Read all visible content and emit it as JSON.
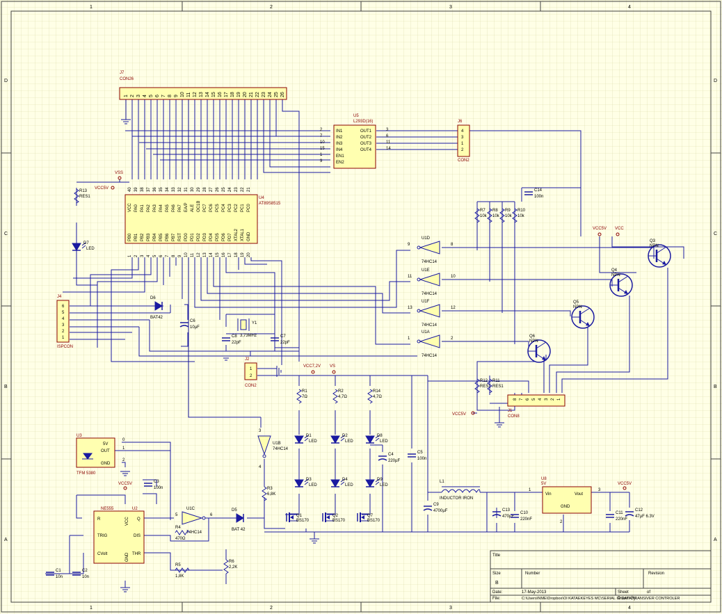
{
  "colors": {
    "background": "#ffffe6",
    "grid": "#d9d9a8",
    "border": "#404040",
    "wire": "#1a1aa0",
    "component": "#8b0000",
    "component_fill": "#ffffb0",
    "label": "#000000",
    "power": "#8b0000"
  },
  "border": {
    "columns": [
      "1",
      "2",
      "3",
      "4"
    ],
    "rows": [
      "D",
      "C",
      "B",
      "A"
    ]
  },
  "connectors": {
    "J7": {
      "ref": "J7",
      "name": "CON26",
      "pins": [
        "1",
        "2",
        "3",
        "4",
        "5",
        "6",
        "7",
        "8",
        "9",
        "10",
        "11",
        "12",
        "13",
        "14",
        "15",
        "16",
        "17",
        "18",
        "19",
        "20",
        "21",
        "22",
        "23",
        "24",
        "25",
        "26"
      ]
    },
    "J6": {
      "ref": "J6",
      "name": "CON2",
      "pins": [
        "4",
        "3",
        "1",
        "2"
      ]
    },
    "J4": {
      "ref": "J4",
      "name": "ISPCON",
      "pins": [
        "6",
        "5",
        "4",
        "3",
        "2",
        "1"
      ]
    },
    "J2": {
      "ref": "J2",
      "name": "CON2",
      "pins": [
        "1",
        "2"
      ]
    },
    "J1": {
      "ref": "J1",
      "name": "CON8",
      "pins": [
        "8",
        "7",
        "6",
        "5",
        "4",
        "3",
        "2",
        "1"
      ]
    }
  },
  "ics": {
    "U5": {
      "ref": "U5",
      "part": "L293D(16)",
      "inputs": [
        "IN1",
        "IN2",
        "IN3",
        "IN4",
        "EN1",
        "EN2"
      ],
      "input_pins": [
        "2",
        "7",
        "10",
        "15",
        "1",
        "9"
      ],
      "outputs": [
        "OUT1",
        "OUT2",
        "OUT3",
        "OUT4"
      ],
      "output_pins": [
        "3",
        "6",
        "11",
        "14"
      ]
    },
    "U4": {
      "ref": "U4",
      "part": "AT89S8515",
      "top_labels": [
        "VCC",
        "PA0",
        "PA1",
        "PA2",
        "PA3",
        "PA4",
        "PA5",
        "PA6",
        "PA7",
        "EA/P",
        "ALE",
        "OC1B",
        "PC7",
        "PC6",
        "PC5",
        "PC4",
        "PC3",
        "PC2",
        "PC1",
        "PC0"
      ],
      "top_pins": [
        "40",
        "39",
        "38",
        "37",
        "36",
        "35",
        "34",
        "33",
        "32",
        "31",
        "30",
        "29",
        "28",
        "27",
        "26",
        "25",
        "24",
        "23",
        "22",
        "21"
      ],
      "bottom_labels": [
        "PB0",
        "PB1",
        "PB2",
        "PB3",
        "PB4",
        "PB5",
        "PB6",
        "PB7",
        "RST",
        "PD0",
        "PD1",
        "PD2",
        "PD3",
        "PD4",
        "PD5",
        "PD6",
        "PD7",
        "XTAL2",
        "XTAL1",
        "GND"
      ],
      "bottom_pins": [
        "1",
        "2",
        "3",
        "4",
        "5",
        "6",
        "7",
        "8",
        "9",
        "10",
        "11",
        "12",
        "13",
        "14",
        "15",
        "16",
        "17",
        "18",
        "19",
        "20"
      ]
    },
    "U2": {
      "ref": "U2",
      "part": "NE555",
      "labels": [
        "R",
        "VCC",
        "Q",
        "TRIG",
        "DIS",
        "CVolt",
        "GND",
        "THR"
      ]
    },
    "U3": {
      "ref": "U3",
      "part": "TFM 5380",
      "labels": [
        "5V",
        "OUT",
        "GND"
      ],
      "pins": [
        "0",
        "1",
        "2"
      ]
    },
    "U8": {
      "ref": "U8",
      "part": "5V",
      "labels": [
        "Vin",
        "Vout",
        "GND"
      ],
      "pins": [
        "1",
        "3",
        "2"
      ]
    }
  },
  "inverters": [
    {
      "ref": "U1D",
      "part": "74HC14",
      "in": "8",
      "out": "9"
    },
    {
      "ref": "U1E",
      "part": "74HC14",
      "in": "10",
      "out": "11"
    },
    {
      "ref": "U1F",
      "part": "74HC14",
      "in": "12",
      "out": "13"
    },
    {
      "ref": "U1A",
      "part": "74HC14",
      "in": "2",
      "out": "1"
    },
    {
      "ref": "U1B",
      "part": "74HC14",
      "in": "3",
      "out": "4"
    },
    {
      "ref": "U1C",
      "part": "74HC14",
      "in": "5",
      "out": "6"
    }
  ],
  "transistors": [
    {
      "ref": "Q3",
      "type": "NPN"
    },
    {
      "ref": "Q4",
      "type": "NPN"
    },
    {
      "ref": "Q5",
      "type": "NPN"
    },
    {
      "ref": "Q6",
      "type": "NPN"
    },
    {
      "ref": "Q1",
      "type": "BS170"
    },
    {
      "ref": "Q2",
      "type": "BS170"
    },
    {
      "ref": "Q7",
      "type": "BS170"
    }
  ],
  "resistors": [
    {
      "ref": "R13",
      "value": "RES1"
    },
    {
      "ref": "R7",
      "value": "10k"
    },
    {
      "ref": "R8",
      "value": "10k"
    },
    {
      "ref": "R9",
      "value": "10k"
    },
    {
      "ref": "R10",
      "value": "10k"
    },
    {
      "ref": "R12",
      "value": "RES1"
    },
    {
      "ref": "R11",
      "value": "RES1"
    },
    {
      "ref": "R1",
      "value": "7Ω"
    },
    {
      "ref": "R2",
      "value": "4,7Ω"
    },
    {
      "ref": "R14",
      "value": "4,7Ω"
    },
    {
      "ref": "R3",
      "value": "6,8K"
    },
    {
      "ref": "R4",
      "value": "470Ω"
    },
    {
      "ref": "R5",
      "value": "1,8K"
    },
    {
      "ref": "R6",
      "value": "2,2K"
    }
  ],
  "capacitors": [
    {
      "ref": "C14",
      "value": "100n"
    },
    {
      "ref": "C6",
      "value": "10µF"
    },
    {
      "ref": "C8",
      "value": "22pF"
    },
    {
      "ref": "C7",
      "value": "22pF"
    },
    {
      "ref": "C4",
      "value": "220µF"
    },
    {
      "ref": "C5",
      "value": "100n"
    },
    {
      "ref": "C3",
      "value": "100n"
    },
    {
      "ref": "C1",
      "value": "10n"
    },
    {
      "ref": "C2",
      "value": "10n"
    },
    {
      "ref": "C9",
      "value": "4700µF"
    },
    {
      "ref": "C13",
      "value": "470µF"
    },
    {
      "ref": "C10",
      "value": "220nF"
    },
    {
      "ref": "C11",
      "value": "220nF"
    },
    {
      "ref": "C12",
      "value": "47µF 6.3V"
    }
  ],
  "diodes": [
    {
      "ref": "D7",
      "value": "LED"
    },
    {
      "ref": "D6",
      "value": "BAT42"
    },
    {
      "ref": "D5",
      "value": "BAT 42"
    },
    {
      "ref": "D1",
      "value": "LED"
    },
    {
      "ref": "D2",
      "value": "LED"
    },
    {
      "ref": "D8",
      "value": "LED"
    },
    {
      "ref": "D3",
      "value": "LED"
    },
    {
      "ref": "D4",
      "value": "LED"
    },
    {
      "ref": "D9",
      "value": "LED"
    }
  ],
  "misc": {
    "crystal_ref": "Y1",
    "crystal_value": "3,73MHz",
    "inductor_ref": "L1",
    "inductor_value": "INDUCTOR IRON"
  },
  "power_labels": {
    "vss": "VSS",
    "vcc5v": "VCC5V",
    "vcc7": "VCC7,2V",
    "vs": "VS",
    "vcc": "VCC"
  },
  "title_block": {
    "title_label": "Title",
    "size_label": "Size",
    "size_value": "B",
    "number_label": "Number",
    "revision_label": "Revision",
    "date_label": "Date:",
    "date_value": "17-May-2013",
    "sheet_label": "Sheet",
    "of_label": "of",
    "file_label": "File:",
    "file_value": "C:\\Users\\NME\\Dropbox\\Ol KATAEKEYES MC\\SERIAL IR DATA TRANSIVER CONTROLER",
    "drawn_label": "Drawn By:"
  }
}
